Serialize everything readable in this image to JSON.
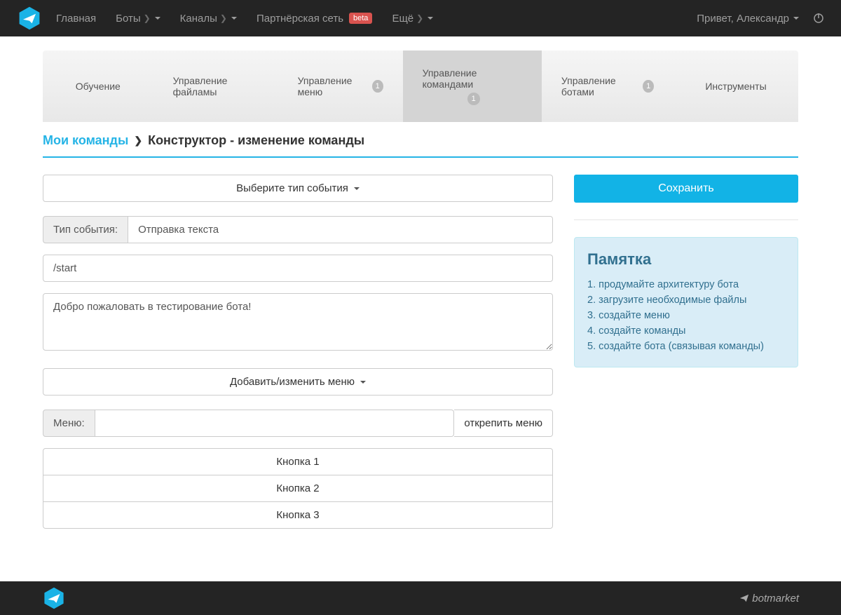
{
  "topnav": {
    "items": [
      {
        "label": "Главная"
      },
      {
        "label": "Боты"
      },
      {
        "label": "Каналы"
      },
      {
        "label": "Партнёрская сеть",
        "beta": "beta"
      },
      {
        "label": "Ещё"
      }
    ],
    "greeting": "Привет, Александр"
  },
  "tabs": [
    {
      "label": "Обучение"
    },
    {
      "label": "Управление файламы"
    },
    {
      "label": "Управление меню",
      "badge": "1"
    },
    {
      "label": "Управление командами",
      "badge": "1",
      "active": true
    },
    {
      "label": "Управление ботами",
      "badge": "1"
    },
    {
      "label": "Инструменты"
    }
  ],
  "breadcrumb": {
    "link": "Мои команды",
    "current": "Конструктор - изменение команды"
  },
  "form": {
    "event_type_dropdown": "Выберите тип события",
    "event_type_label": "Тип события:",
    "event_type_value": "Отправка текста",
    "command_input": "/start",
    "message_text": "Добро пожаловать в тестирование бота!",
    "menu_dropdown": "Добавить/изменить меню",
    "menu_label": "Меню:",
    "menu_value": "",
    "unpin_menu": "открепить меню",
    "buttons": [
      "Кнопка 1",
      "Кнопка 2",
      "Кнопка 3"
    ]
  },
  "sidebar": {
    "save": "Сохранить",
    "memo_title": "Памятка",
    "memo_items": [
      "1. продумайте архитектуру бота",
      "2. загрузите необходимые файлы",
      "3. создайте меню",
      "4. создайте команды",
      "5. создайте бота (связывая команды)"
    ]
  },
  "footer": {
    "brand": "botmarket"
  }
}
